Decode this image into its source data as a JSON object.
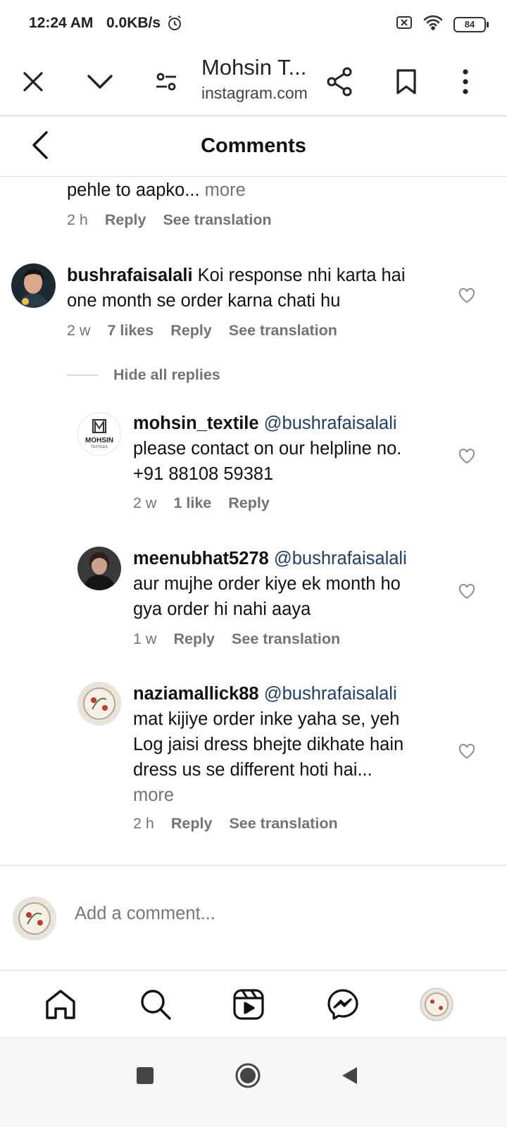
{
  "status_bar": {
    "time": "12:24 AM",
    "speed": "0.0KB/s",
    "battery": "84"
  },
  "browser": {
    "title": "Mohsin T...",
    "url": "instagram.com"
  },
  "header": {
    "title": "Comments"
  },
  "comments": [
    {
      "text": "pehle to aapko...",
      "more": "more",
      "time": "2 h",
      "reply": "Reply",
      "translation": "See translation"
    },
    {
      "username": "bushrafaisalali",
      "text_line1": "Koi response nhi karta hai",
      "text_line2": "one month se order karna chati hu",
      "time": "2 w",
      "likes": "7 likes",
      "reply": "Reply",
      "translation": "See translation"
    }
  ],
  "hide_replies": "Hide all replies",
  "replies": [
    {
      "username": "mohsin_textile",
      "mention": "@bushrafaisalali",
      "text_line1": "please contact on our helpline no.",
      "text_line2": "+91 88108 59381",
      "time": "2 w",
      "likes": "1 like",
      "reply": "Reply",
      "avatar_text": "MOHSIN",
      "avatar_subtext": "TEXTILES"
    },
    {
      "username": "meenubhat5278",
      "mention": "@bushrafaisalali",
      "text_line1": "aur mujhe order kiye ek month ho",
      "text_line2": "gya order hi nahi aaya",
      "time": "1 w",
      "reply": "Reply",
      "translation": "See translation"
    },
    {
      "username": "naziamallick88",
      "mention": "@bushrafaisalali",
      "text_line1": "mat kijiye order inke yaha se, yeh",
      "text_line2": "Log jaisi dress bhejte dikhate hain",
      "text_line3": "dress us se different hoti hai...",
      "more": "more",
      "time": "2 h",
      "reply": "Reply",
      "translation": "See translation"
    }
  ],
  "add_comment": {
    "placeholder": "Add a comment..."
  },
  "colors": {
    "meta_gray": "#737373",
    "mention_blue": "#1f3f66",
    "divider": "#dcdcdc"
  },
  "icons": [
    "close-icon",
    "chevron-down-icon",
    "site-settings-icon",
    "share-icon",
    "bookmark-icon",
    "more-icon",
    "back-icon",
    "heart-icon",
    "home-icon",
    "search-icon",
    "reels-icon",
    "messenger-icon"
  ]
}
